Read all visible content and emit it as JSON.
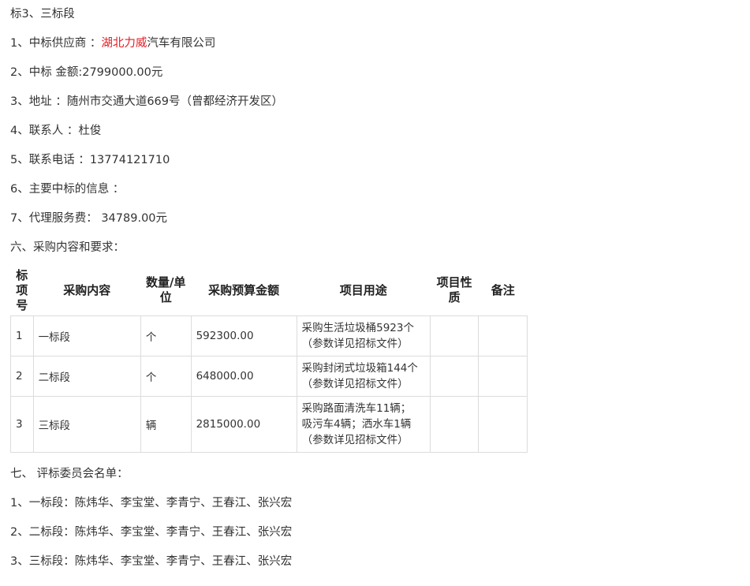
{
  "lines_top": [
    "标3、三标段",
    [
      "1、中标供应商 ：",
      "湖北力威",
      "汽车有限公司"
    ],
    "2、中标 金额:2799000.00元",
    "3、地址 ：随州市交通大道669号（曾都经济开发区）",
    "4、联系人 ：杜俊",
    "5、联系电话 ：13774121710",
    "6、主要中标的信息 ：",
    "7、代理服务费： 34789.00元",
    "六、采购内容和要求："
  ],
  "table": {
    "headers": [
      "标项号",
      "采购内容",
      "数量/单位",
      "采购预算金额",
      "项目用途",
      "项目性质",
      "备注"
    ],
    "rows": [
      {
        "no": "1",
        "content": "一标段",
        "unit": "个",
        "budget": "592300.00",
        "use": [
          "采购生活垃圾桶5923个",
          "（参数详见招标文件）"
        ],
        "nature": "",
        "remark": ""
      },
      {
        "no": "2",
        "content": "二标段",
        "unit": "个",
        "budget": "648000.00",
        "use": [
          "采购封闭式垃圾箱144个",
          "（参数详见招标文件）"
        ],
        "nature": "",
        "remark": ""
      },
      {
        "no": "3",
        "content": "三标段",
        "unit": "辆",
        "budget": "2815000.00",
        "use": [
          "采购路面清洗车11辆；",
          "吸污车4辆；洒水车1辆",
          "（参数详见招标文件）"
        ],
        "nature": "",
        "remark": ""
      }
    ]
  },
  "lines_bottom": [
    "七、 评标委员会名单：",
    "1、一标段：陈炜华、李宝堂、李青宁、王春江、张兴宏",
    "2、二标段：陈炜华、李宝堂、李青宁、王春江、张兴宏",
    "3、三标段：陈炜华、李宝堂、李青宁、王春江、张兴宏"
  ]
}
